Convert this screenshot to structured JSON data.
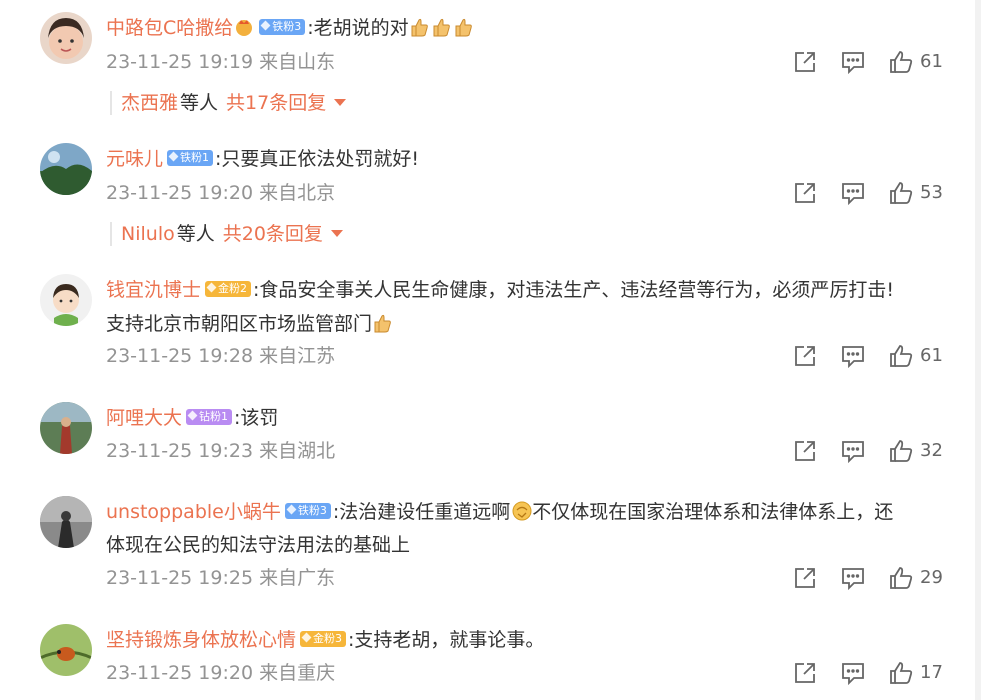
{
  "comments": [
    {
      "user": "中路包C哈撒给",
      "badge": "铁粉3",
      "text": ":老胡说的对",
      "emojis": [
        "thumbs-up-emoji",
        "thumbs-up-emoji",
        "thumbs-up-emoji"
      ],
      "time": "23-11-25 19:19",
      "location": "来自山东",
      "likes": "61",
      "replies": {
        "names": "杰西雅",
        "etc": "等人",
        "total": "共17条回复"
      }
    },
    {
      "user": "元味儿",
      "badge": "铁粉1",
      "text": ":只要真正依法处罚就好!",
      "time": "23-11-25 19:20",
      "location": "来自北京",
      "likes": "53",
      "replies": {
        "names": "Nilulo",
        "etc": "等人",
        "total": "共20条回复"
      }
    },
    {
      "user": "钱宜氿博士",
      "badge": "金粉2",
      "text": ":食品安全事关人民生命健康，对违法生产、违法经营等行为，必须严厉打击!",
      "text_line2": "支持北京市朝阳区市场监管部门",
      "time": "23-11-25 19:28",
      "location": "来自江苏",
      "likes": "61"
    },
    {
      "user": "阿哩大大",
      "badge": "钻粉1",
      "text": ":该罚",
      "time": "23-11-25 19:23",
      "location": "来自湖北",
      "likes": "32"
    },
    {
      "user": "unstoppable小蜗牛",
      "badge": "铁粉3",
      "text": ":法治建设任重道远啊",
      "text_after_emoji": "不仅体现在国家治理体系和法律体系上，还",
      "text_line2": "体现在公民的知法守法用法的基础上",
      "time": "23-11-25 19:25",
      "location": "来自广东",
      "likes": "29"
    },
    {
      "user": "坚持锻炼身体放松心情",
      "badge": "金粉3",
      "text": ":支持老胡，就事论事。",
      "time": "23-11-25 19:20",
      "location": "来自重庆",
      "likes": "17"
    }
  ],
  "colors": {
    "username": "#eb7350",
    "meta": "#939393",
    "badge_blue": "#6aa6f5",
    "badge_gold": "#f6b63a",
    "badge_purple": "#b98cf2"
  },
  "icons": {
    "share": "share-icon",
    "comment": "comment-icon",
    "like": "thumbs-up-icon"
  }
}
